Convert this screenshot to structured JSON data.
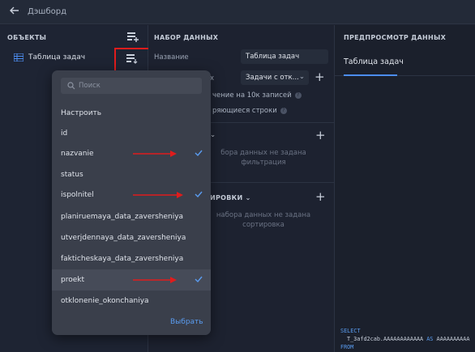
{
  "header": {
    "title": "Дэшборд"
  },
  "objects": {
    "section_title": "ОБЪЕКТЫ",
    "items": [
      {
        "label": "Таблица задач"
      }
    ]
  },
  "dataset": {
    "section_title": "НАБОР ДАННЫХ",
    "name_label": "Название",
    "name_value": "Таблица задач",
    "source_label_visible": "х",
    "source_value": "Задачи с отк...",
    "limit_text": "чение на 10к записей",
    "repeat_text": "ряющиеся строки",
    "filter_empty": [
      "бора данных не задана",
      "фильтрация"
    ],
    "sort_section_title": "ИРОВКИ",
    "sort_empty": [
      "набора данных не задана",
      "сортировка"
    ]
  },
  "preview": {
    "section_title": "ПРЕДПРОСМОТР ДАННЫХ",
    "tab_label": "Таблица задач",
    "sql": {
      "select_kw": "SELECT",
      "line2_prefix": "T_3afd2cab.AAAAAAAAAAAA",
      "as_kw": "AS",
      "line2_suffix": "AAAAAAAAAA",
      "from_kw": "FROM"
    }
  },
  "columns_dropdown": {
    "search_placeholder": "Поиск",
    "items": [
      {
        "label": "Настроить",
        "checked": false
      },
      {
        "label": "id",
        "checked": false
      },
      {
        "label": "nazvanie",
        "checked": true
      },
      {
        "label": "status",
        "checked": false
      },
      {
        "label": "ispolnitel",
        "checked": true
      },
      {
        "label": "planiruemaya_data_zaversheniya",
        "checked": false
      },
      {
        "label": "utverjdennaya_data_zaversheniya",
        "checked": false
      },
      {
        "label": "fakticheskaya_data_zaversheniya",
        "checked": false
      },
      {
        "label": "proekt",
        "checked": true
      },
      {
        "label": "otklonenie_okonchaniya",
        "checked": false
      }
    ],
    "choose_label": "Выбрать"
  },
  "colors": {
    "accent": "#4c8df0",
    "annotation_red": "#e01c1c"
  }
}
